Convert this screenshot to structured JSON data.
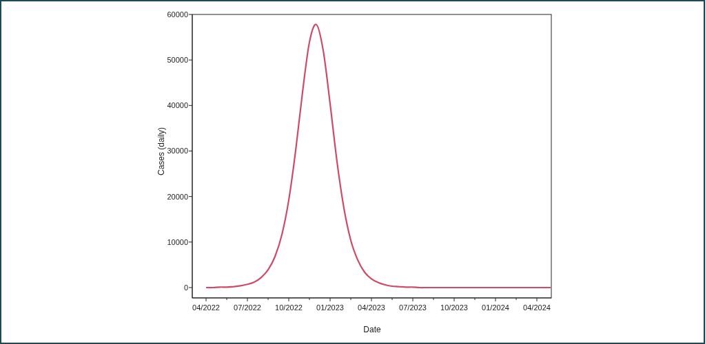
{
  "chart_data": {
    "type": "line",
    "xlabel": "Date",
    "ylabel": "Cases (daily)",
    "categories": [
      "04/2022",
      null,
      null,
      null,
      null,
      null,
      "07/2022",
      null,
      null,
      null,
      null,
      null,
      "10/2022",
      null,
      null,
      null,
      null,
      null,
      "01/2023",
      null,
      null,
      null,
      null,
      null,
      "04/2023",
      null,
      null,
      null,
      null,
      null,
      "07/2023",
      null,
      null,
      null,
      null,
      null,
      "10/2023",
      null,
      null,
      null,
      null,
      null,
      "01/2024",
      null,
      null,
      null,
      null,
      null,
      "04/2024",
      null,
      null
    ],
    "series": [
      {
        "color": "#d04a68",
        "values": [
          0,
          0,
          100,
          100,
          200,
          400,
          700,
          1200,
          2200,
          3900,
          6800,
          11600,
          19200,
          30100,
          42900,
          53900,
          57800,
          52100,
          40400,
          27700,
          17500,
          10400,
          6100,
          3400,
          1900,
          1100,
          600,
          300,
          200,
          100,
          100,
          0,
          0,
          0,
          0,
          0,
          0,
          0,
          0,
          0,
          0,
          0,
          0,
          0,
          0,
          0,
          0,
          0,
          0,
          0,
          0
        ]
      }
    ],
    "ylim": [
      -2270,
      60000
    ],
    "yticks": [
      0,
      10000,
      20000,
      30000,
      40000,
      50000,
      60000
    ]
  }
}
